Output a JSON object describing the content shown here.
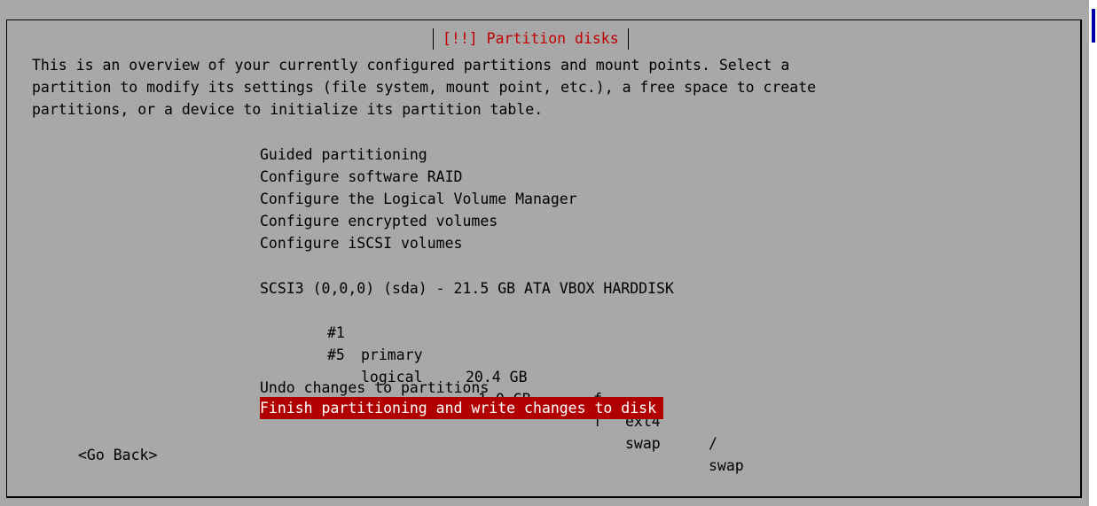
{
  "dialog": {
    "title": "[!!] Partition disks",
    "intro_lines": [
      "This is an overview of your currently configured partitions and mount points. Select a",
      "partition to modify its settings (file system, mount point, etc.), a free space to create",
      "partitions, or a device to initialize its partition table."
    ],
    "menu_items": [
      "Guided partitioning",
      "Configure software RAID",
      "Configure the Logical Volume Manager",
      "Configure encrypted volumes",
      "Configure iSCSI volumes"
    ],
    "disk": {
      "label": "SCSI3 (0,0,0) (sda) - 21.5 GB ATA VBOX HARDDISK",
      "partitions": [
        {
          "num": "#1",
          "type": "primary",
          "size": "20.4 GB",
          "flag": "f",
          "fs": "ext4",
          "mount": "/"
        },
        {
          "num": "#5",
          "type": "logical",
          "size": "1.0 GB",
          "flag": "f",
          "fs": "swap",
          "mount": "swap"
        }
      ]
    },
    "undo_label": "Undo changes to partitions",
    "finish_label": "Finish partitioning and write changes to disk",
    "go_back_label": "<Go Back>"
  },
  "colors": {
    "background": "#a8a8a8",
    "title": "#c00000",
    "selection_bg": "#b00000",
    "selection_fg": "#ffffff",
    "accent_bar": "#0000a8"
  }
}
